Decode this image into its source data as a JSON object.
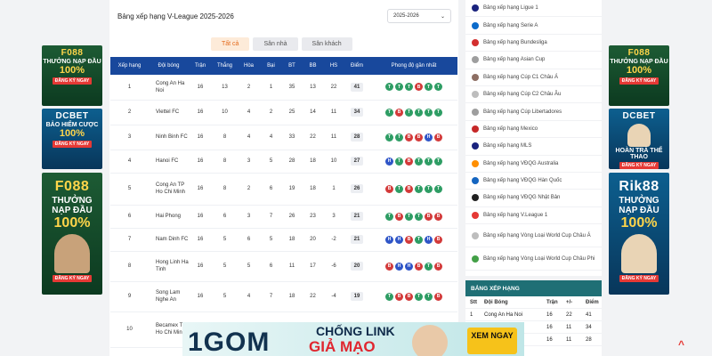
{
  "title": "Bảng xếp hạng V-League 2025-2026",
  "season_select": "2025-2026",
  "tabs": [
    "Tất cả",
    "Sân nhà",
    "Sân khách"
  ],
  "table": {
    "headers": [
      "Xếp hạng",
      "Đội bóng",
      "Trận",
      "Thắng",
      "Hòa",
      "Bại",
      "BT",
      "BB",
      "HS",
      "Điểm",
      "Phong độ gần nhất"
    ],
    "rows": [
      {
        "rank": "1",
        "team": "Cong An Ha Noi",
        "p": "16",
        "w": "13",
        "d": "2",
        "l": "1",
        "gf": "35",
        "ga": "13",
        "gd": "22",
        "pts": "41",
        "form": [
          "T",
          "T",
          "T",
          "B",
          "T",
          "T"
        ]
      },
      {
        "rank": "2",
        "team": "Viettel FC",
        "p": "16",
        "w": "10",
        "d": "4",
        "l": "2",
        "gf": "25",
        "ga": "14",
        "gd": "11",
        "pts": "34",
        "form": [
          "T",
          "B",
          "T",
          "T",
          "T",
          "T"
        ]
      },
      {
        "rank": "3",
        "team": "Ninh Binh FC",
        "p": "16",
        "w": "8",
        "d": "4",
        "l": "4",
        "gf": "33",
        "ga": "22",
        "gd": "11",
        "pts": "28",
        "form": [
          "T",
          "T",
          "B",
          "B",
          "H",
          "B"
        ]
      },
      {
        "rank": "4",
        "team": "Hanoi FC",
        "p": "16",
        "w": "8",
        "d": "3",
        "l": "5",
        "gf": "28",
        "ga": "18",
        "gd": "10",
        "pts": "27",
        "form": [
          "H",
          "T",
          "B",
          "T",
          "T",
          "T"
        ]
      },
      {
        "rank": "5",
        "team": "Cong An TP Ho Chi Minh",
        "p": "16",
        "w": "8",
        "d": "2",
        "l": "6",
        "gf": "19",
        "ga": "18",
        "gd": "1",
        "pts": "26",
        "form": [
          "B",
          "T",
          "B",
          "T",
          "T",
          "T"
        ]
      },
      {
        "rank": "6",
        "team": "Hai Phong",
        "p": "16",
        "w": "6",
        "d": "3",
        "l": "7",
        "gf": "26",
        "ga": "23",
        "gd": "3",
        "pts": "21",
        "form": [
          "T",
          "B",
          "T",
          "T",
          "B",
          "B"
        ]
      },
      {
        "rank": "7",
        "team": "Nam Dinh FC",
        "p": "16",
        "w": "5",
        "d": "6",
        "l": "5",
        "gf": "18",
        "ga": "20",
        "gd": "-2",
        "pts": "21",
        "form": [
          "H",
          "H",
          "B",
          "T",
          "H",
          "B"
        ]
      },
      {
        "rank": "8",
        "team": "Hong Linh Ha Tinh",
        "p": "16",
        "w": "5",
        "d": "5",
        "l": "6",
        "gf": "11",
        "ga": "17",
        "gd": "-6",
        "pts": "20",
        "form": [
          "B",
          "H",
          "H",
          "B",
          "T",
          "B"
        ]
      },
      {
        "rank": "9",
        "team": "Song Lam Nghe An",
        "p": "16",
        "w": "5",
        "d": "4",
        "l": "7",
        "gf": "18",
        "ga": "22",
        "gd": "-4",
        "pts": "19",
        "form": [
          "T",
          "B",
          "B",
          "T",
          "T",
          "B"
        ]
      },
      {
        "rank": "10",
        "team": "Becamex TP Ho Chi Minh",
        "p": "",
        "w": "",
        "d": "",
        "l": "",
        "gf": "",
        "ga": "",
        "gd": "",
        "pts": "",
        "form": []
      }
    ]
  },
  "sidebar": {
    "items": [
      {
        "label": "Bảng xếp hạng Ligue 1",
        "color": "#1a237e"
      },
      {
        "label": "Bảng xếp hạng Serie A",
        "color": "#0b6bcb"
      },
      {
        "label": "Bảng xếp hạng Bundesliga",
        "color": "#d32f2f"
      },
      {
        "label": "Bảng xếp hạng Asian Cup",
        "color": "#9e9e9e"
      },
      {
        "label": "Bảng xếp hạng Cúp C1 Châu Á",
        "color": "#8d6e63"
      },
      {
        "label": "Bảng xếp hạng Cúp C2 Châu Âu",
        "color": "#bdbdbd"
      },
      {
        "label": "Bảng xếp hạng Cúp Libertadores",
        "color": "#9e9e9e"
      },
      {
        "label": "Bảng xếp hạng Mexico",
        "color": "#c62828"
      },
      {
        "label": "Bảng xếp hạng MLS",
        "color": "#1a237e"
      },
      {
        "label": "Bảng xếp hạng VĐQG Australia",
        "color": "#ff8f00"
      },
      {
        "label": "Bảng xếp hạng VĐQG Hàn Quốc",
        "color": "#1565c0"
      },
      {
        "label": "Bảng xếp hạng VĐQG Nhật Bản",
        "color": "#212121"
      },
      {
        "label": "Bảng xếp hạng V.League 1",
        "color": "#e53935"
      },
      {
        "label": "Bảng xếp hạng Vòng Loại World Cup Châu Á",
        "color": "#bdbdbd"
      },
      {
        "label": "Bảng xếp hạng Vòng Loại World Cup Châu Phi",
        "color": "#43a047"
      }
    ]
  },
  "mini_table": {
    "header": "BẢNG XẾP HẠNG",
    "columns": [
      "Stt",
      "Đội Bóng",
      "Trận",
      "+/-",
      "Điểm"
    ],
    "rows": [
      {
        "stt": "1",
        "team": "Cong An Ha Noi",
        "p": "16",
        "gd": "22",
        "pts": "41"
      },
      {
        "stt": "2",
        "team": "",
        "p": "16",
        "gd": "11",
        "pts": "34"
      },
      {
        "stt": "3",
        "team": "",
        "p": "16",
        "gd": "11",
        "pts": "28"
      }
    ]
  },
  "ads": {
    "left": [
      {
        "brand": "F088",
        "line1": "THƯỞNG NẠP ĐẦU",
        "line2": "100%",
        "cta": "ĐĂNG KÝ NGAY"
      },
      {
        "brand": "DCBET",
        "line1": "BẢO HIỂM CƯỢC",
        "line2": "100%",
        "cta": "ĐĂNG KÝ NGAY"
      },
      {
        "brand": "F088",
        "line1": "THƯỞNG NẠP ĐẦU",
        "line2": "100%",
        "cta": "ĐĂNG KÝ NGAY"
      }
    ],
    "right": [
      {
        "brand": "F088",
        "line1": "THƯỞNG NẠP ĐẦU",
        "line2": "100%",
        "cta": "ĐĂNG KÝ NGAY"
      },
      {
        "brand": "DCBET",
        "line1": "HOÀN TRẢ THỂ THAO",
        "line2": "",
        "cta": "ĐĂNG KÝ NGAY"
      },
      {
        "brand": "Rik88",
        "line1": "THƯỞNG NẠP ĐẦU",
        "line2": "100%",
        "cta": "ĐĂNG KÝ NGAY"
      }
    ],
    "banner": {
      "logo": "1GOM",
      "line1": "CHỐNG LINK",
      "line2": "GIẢ MẠO",
      "cta": "XEM NGAY"
    }
  }
}
